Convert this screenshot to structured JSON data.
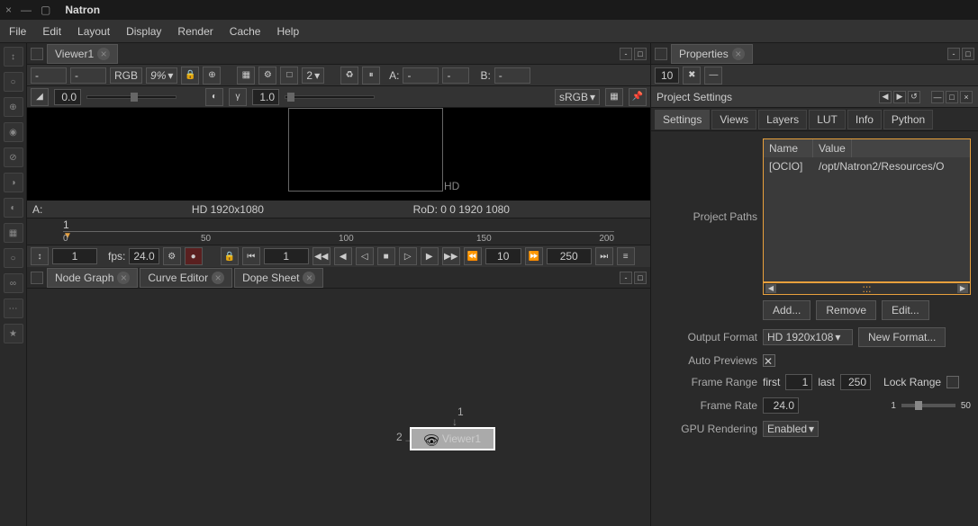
{
  "title": "Natron",
  "menu": [
    "File",
    "Edit",
    "Layout",
    "Display",
    "Render",
    "Cache",
    "Help"
  ],
  "sidebarTools": [
    "↕",
    "○",
    "⊕",
    "◉",
    "⊘",
    "◑",
    "◐",
    "▦",
    "○",
    "∞",
    "⋯",
    "★"
  ],
  "viewer": {
    "tab": "Viewer1",
    "layerA": "-",
    "layerB": "-",
    "channels": "RGB",
    "zoom": "9%",
    "proxyLevel": "2",
    "inputA": "-",
    "inputAWipe": "-",
    "inputBLabel": "B:",
    "inputB": "-",
    "gain": "0.0",
    "gamma": "1.0",
    "colorspace": "sRGB",
    "infoLeft": "A:",
    "resolution": "HD 1920x1080",
    "rod": "RoD: 0 0 1920 1080",
    "hd": "HD",
    "timeline": {
      "marker": "1",
      "ticks": [
        "0",
        "50",
        "100",
        "150",
        "200"
      ]
    },
    "play": {
      "frame": "1",
      "fpsLabel": "fps:",
      "fps": "24.0",
      "jump": "10",
      "last": "250"
    }
  },
  "nodegraph": {
    "tabs": [
      "Node Graph",
      "Curve Editor",
      "Dope Sheet"
    ],
    "node": "Viewer1",
    "in1": "1",
    "in2": "2"
  },
  "properties": {
    "tab": "Properties",
    "maxPanels": "10",
    "panelTitle": "Project Settings",
    "tabs": [
      "Settings",
      "Views",
      "Layers",
      "LUT",
      "Info",
      "Python"
    ],
    "table": {
      "cols": [
        "Name",
        "Value"
      ],
      "row": [
        "[OCIO]",
        "/opt/Natron2/Resources/O"
      ]
    },
    "projectPaths": "Project Paths",
    "btns": {
      "add": "Add...",
      "remove": "Remove",
      "edit": "Edit..."
    },
    "outputFormat": {
      "label": "Output Format",
      "value": "HD 1920x108",
      "newFormat": "New Format..."
    },
    "autoPreviews": "Auto Previews",
    "frameRange": {
      "label": "Frame Range",
      "first": "first",
      "firstVal": "1",
      "last": "last",
      "lastVal": "250",
      "lock": "Lock Range"
    },
    "frameRate": {
      "label": "Frame Rate",
      "value": "24.0",
      "min": "1",
      "max": "50"
    },
    "gpu": {
      "label": "GPU Rendering",
      "value": "Enabled"
    }
  }
}
